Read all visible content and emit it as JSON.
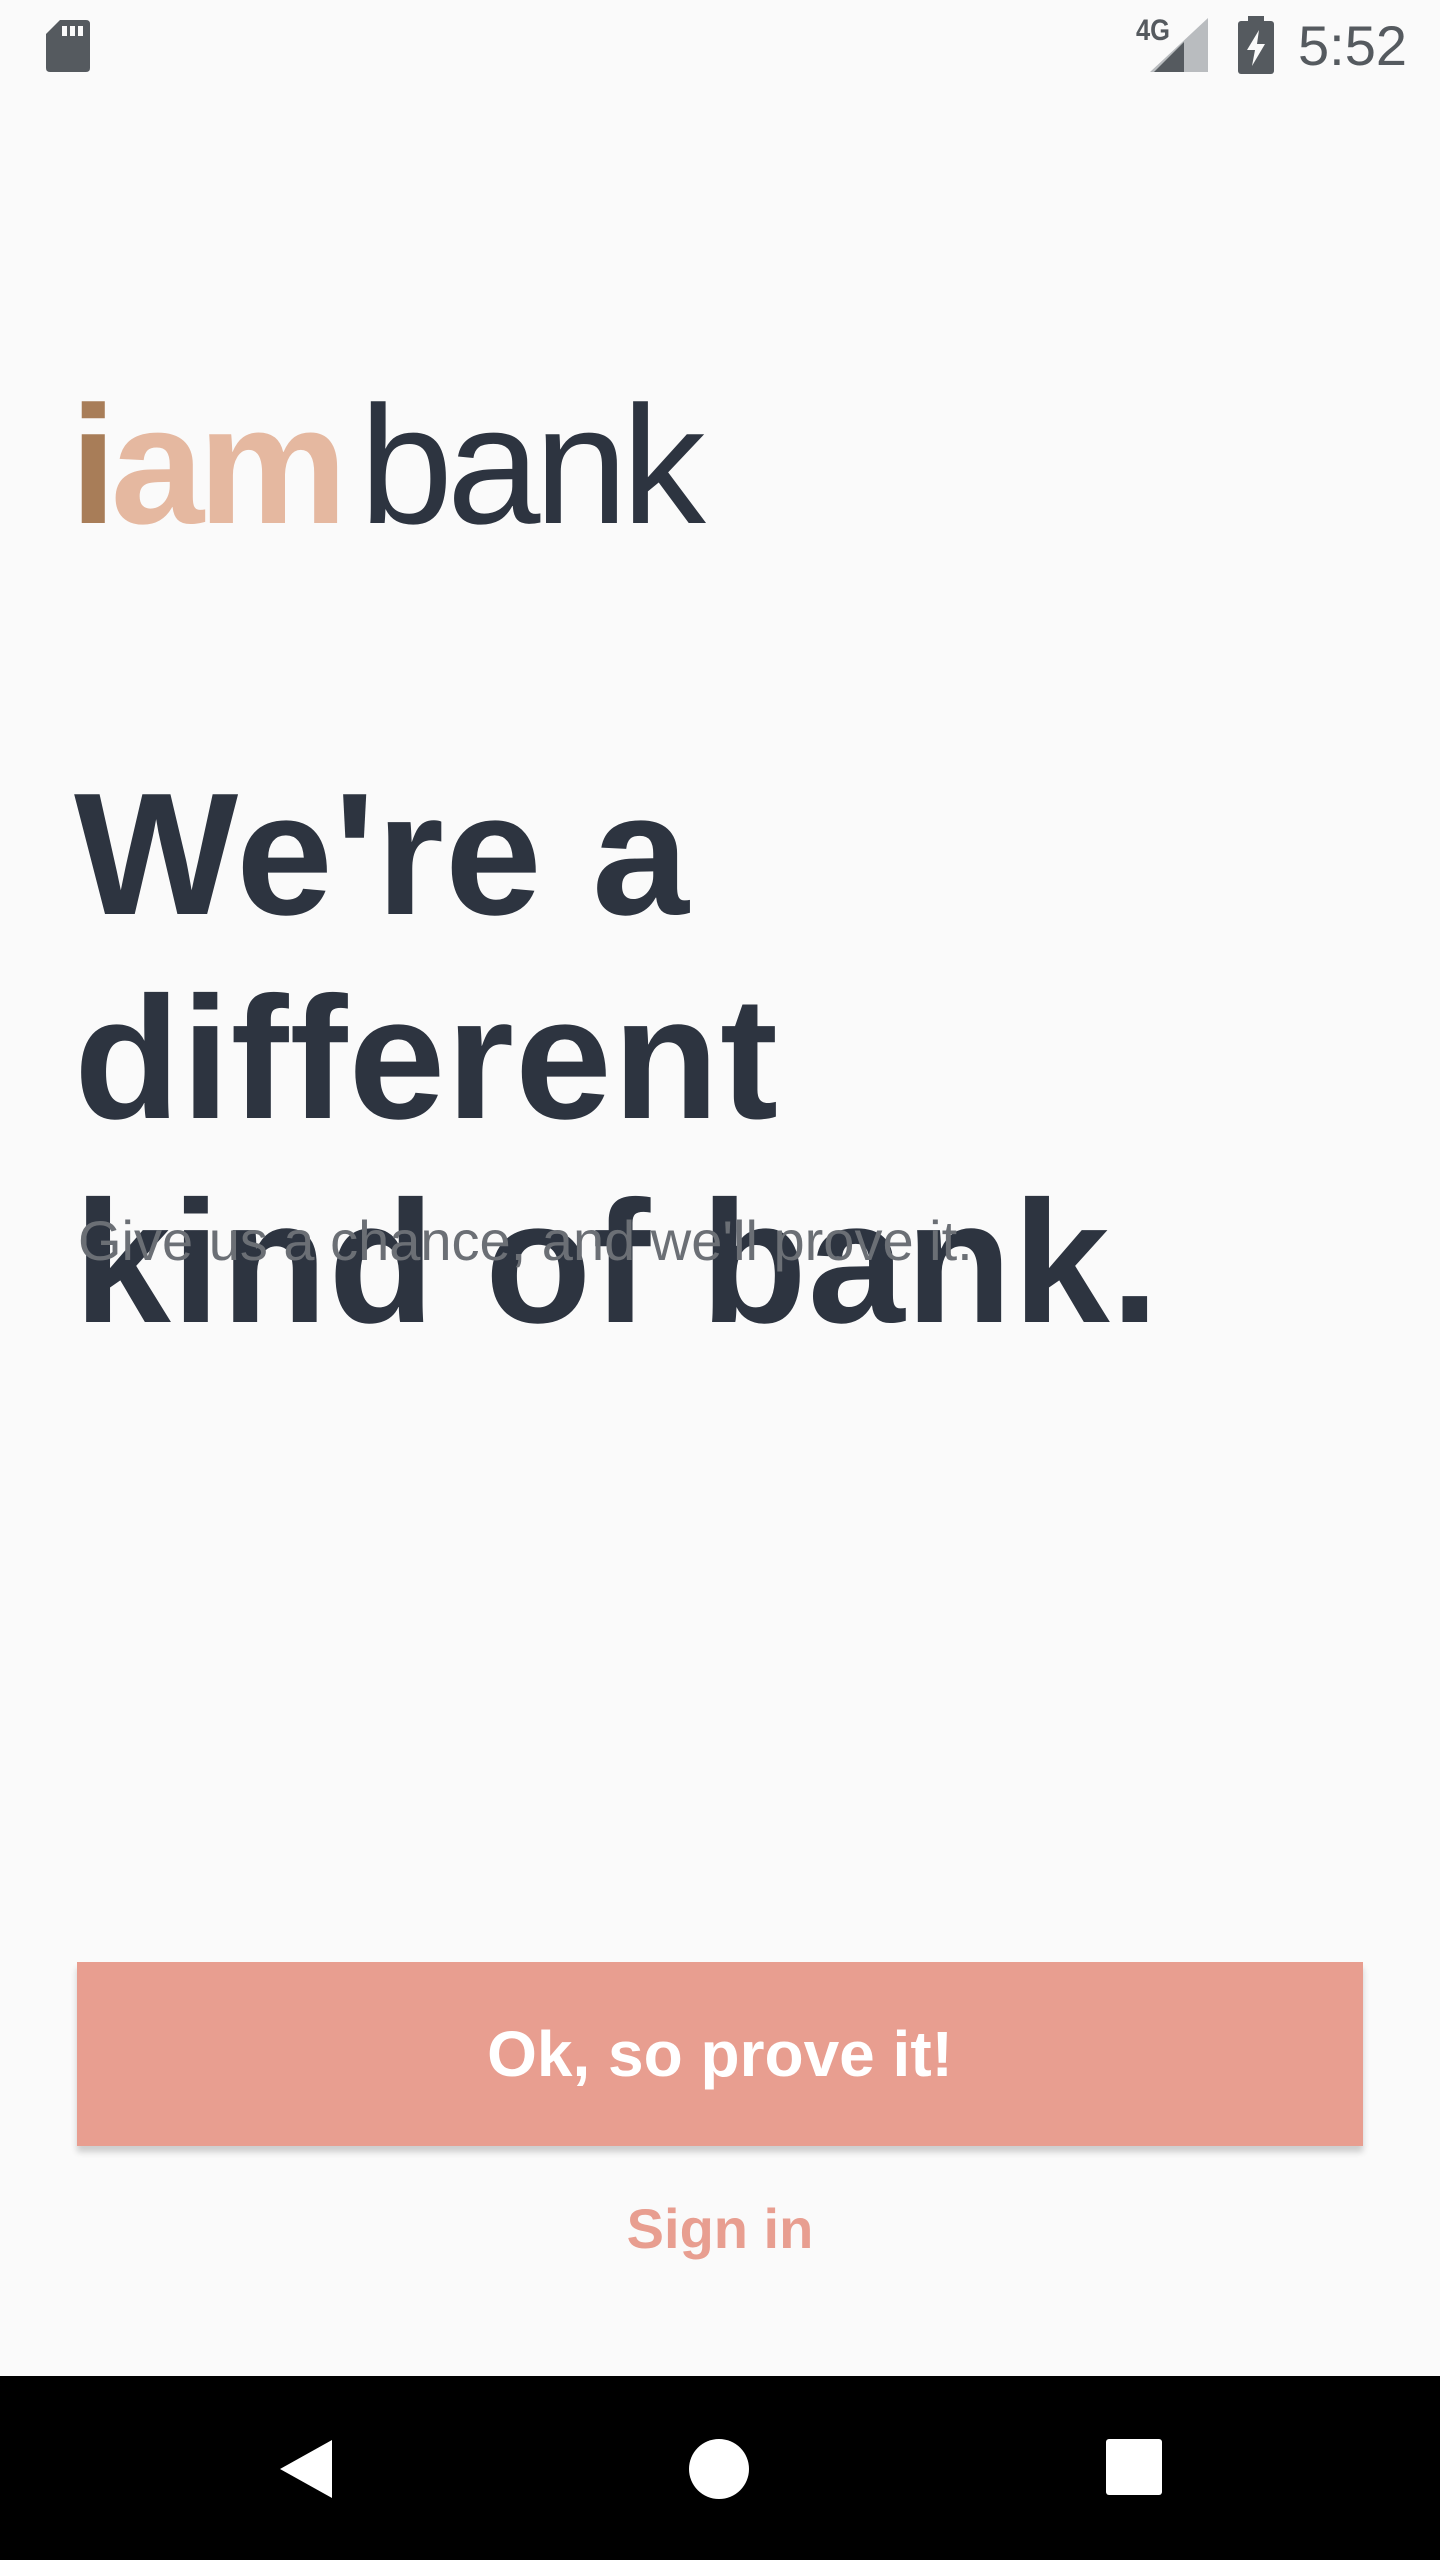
{
  "status_bar": {
    "network": "4G",
    "time": "5:52",
    "icons": [
      "sd-card-icon",
      "signal-icon",
      "battery-charging-icon"
    ]
  },
  "logo": {
    "part_i": "i",
    "part_am": "am",
    "part_bank": "bank",
    "colors": {
      "i": "#a87d58",
      "am": "#e5b8a0",
      "bank": "#2d3440"
    }
  },
  "hero": {
    "headline_line1": "We're a different",
    "headline_line2": "kind of bank.",
    "tagline": "Give us a chance, and we'll prove it."
  },
  "actions": {
    "primary_label": "Ok, so prove it!",
    "secondary_label": "Sign in",
    "accent_color": "#e89e90"
  },
  "nav_bar": {
    "icons": [
      "back-icon",
      "home-icon",
      "recents-icon"
    ]
  }
}
